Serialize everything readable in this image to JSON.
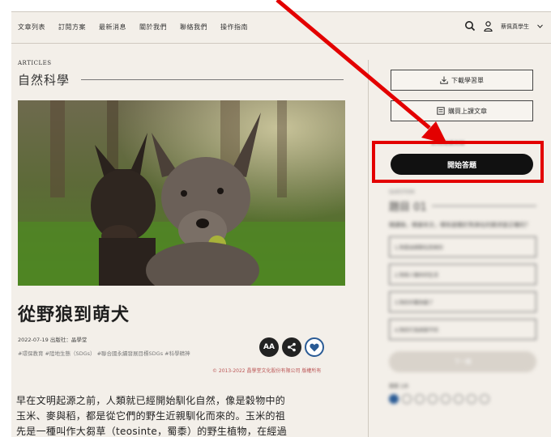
{
  "nav": {
    "items": [
      "文章列表",
      "訂閱方案",
      "最新消息",
      "關於我們",
      "聯絡我們",
      "操作指南"
    ],
    "user_label": "蔡佩真學生"
  },
  "article": {
    "section_label": "ARTICLES",
    "category": "自然科學",
    "title": "從野狼到萌犬",
    "date": "2022-07-19",
    "publisher": "出版社：晶學堂",
    "tags": "#環保教育 #陸地生態（SDGs） #聯合國永續發展目標SDGs #科學精神",
    "copyright": "© 2013-2022 晶學堂文化股份有限公司 版權所有",
    "font_size_label": "AA",
    "body_lines": [
      "早在文明起源之前，人類就已經開始馴化自然，像是穀物中的",
      "玉米、麥與稻，都是從它們的野生近親馴化而來的。玉米的祖",
      "先是一種叫作大芻草（teosinte，蜀黍）的野生植物，在經過"
    ]
  },
  "sidebar": {
    "download_label": "下載學習單",
    "buy_label": "購買上課文章",
    "start_label": "開始答題",
    "note": "此為閱讀測驗",
    "question_kicker": "QUESTION",
    "question_title": "題目 01",
    "question_text": "閱讀後，根據本文，哪些是關於狗演化的敘述是正確的？",
    "options": [
      "1.狗是由狼馴化而來的",
      "2.狗與人類共同生活",
      "3.狗的外觀改變了",
      "4.狗的行為與狼不同"
    ],
    "next_label": "下一題",
    "progress_label": "進度 1/8"
  },
  "annotation": {
    "color": "#e30000"
  }
}
